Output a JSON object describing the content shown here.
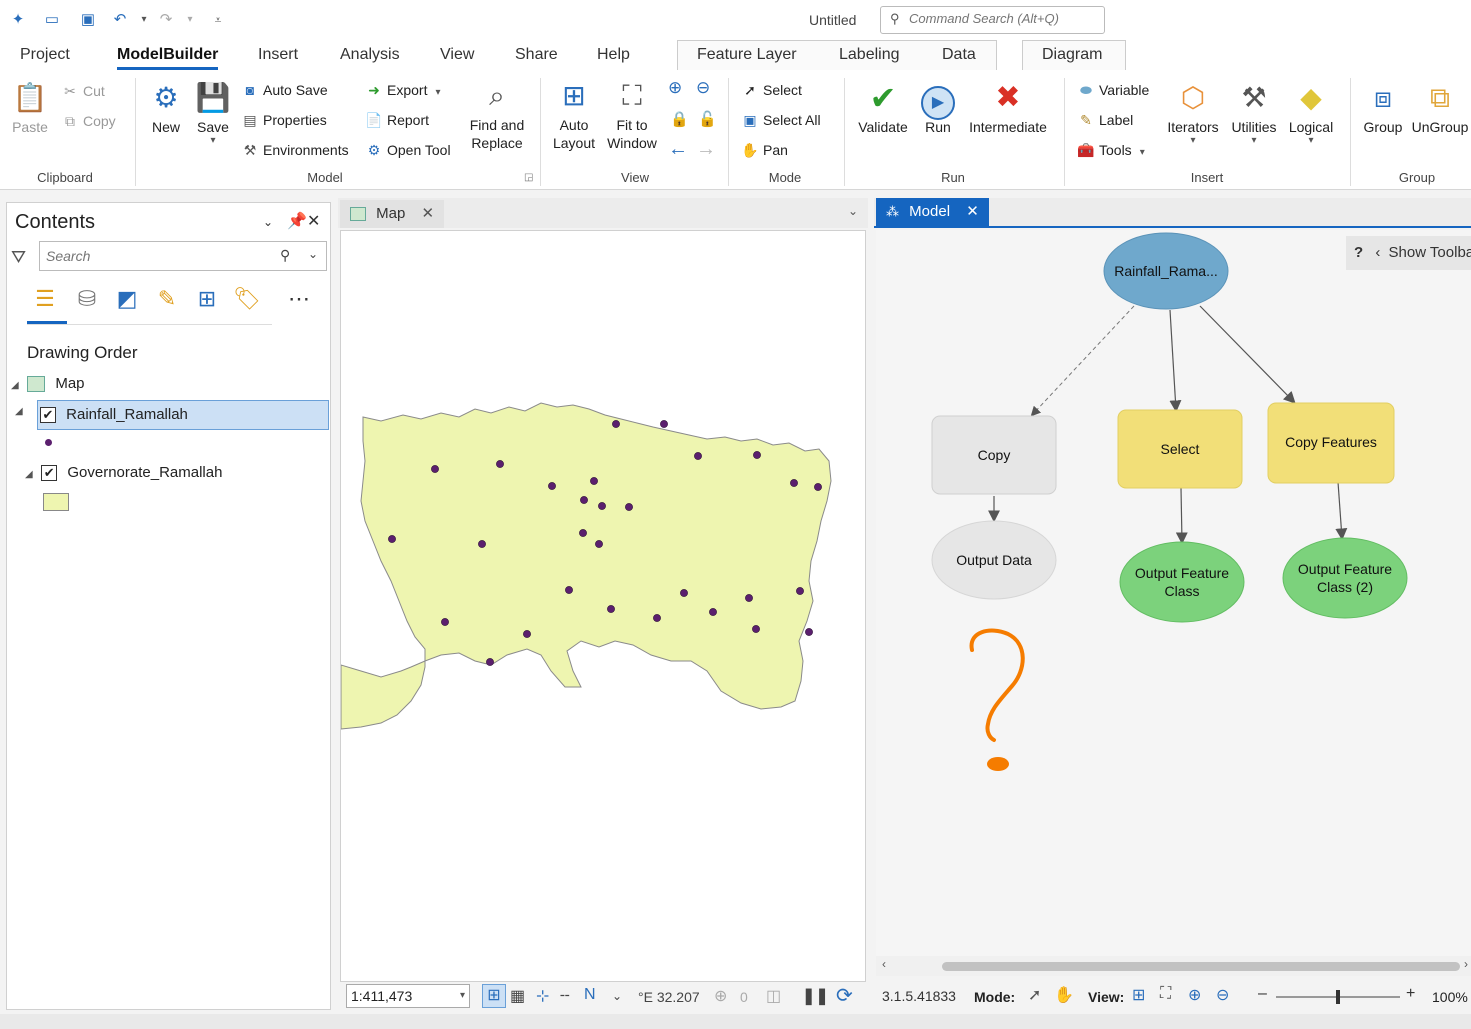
{
  "app": {
    "doc_title": "Untitled",
    "command_search_placeholder": "Command Search (Alt+Q)"
  },
  "ribbon_tabs": [
    "Project",
    "ModelBuilder",
    "Insert",
    "Analysis",
    "View",
    "Share",
    "Help"
  ],
  "context_tabs": [
    "Feature Layer",
    "Labeling",
    "Data",
    "Diagram"
  ],
  "ribbon": {
    "clipboard": {
      "label": "Clipboard",
      "paste": "Paste",
      "cut": "Cut",
      "copy": "Copy"
    },
    "model": {
      "label": "Model",
      "new": "New",
      "save": "Save",
      "auto_save": "Auto Save",
      "properties": "Properties",
      "environments": "Environments",
      "export": "Export",
      "report": "Report",
      "open_tool": "Open Tool",
      "find_replace_1": "Find and",
      "find_replace_2": "Replace"
    },
    "view": {
      "label": "View",
      "auto_layout_1": "Auto",
      "auto_layout_2": "Layout",
      "fit_window_1": "Fit to",
      "fit_window_2": "Window"
    },
    "mode": {
      "label": "Mode",
      "select": "Select",
      "select_all": "Select All",
      "pan": "Pan"
    },
    "run": {
      "label": "Run",
      "validate": "Validate",
      "run": "Run",
      "intermediate": "Intermediate"
    },
    "insert": {
      "label": "Insert",
      "variable": "Variable",
      "label_btn": "Label",
      "tools": "Tools",
      "iterators": "Iterators",
      "utilities": "Utilities",
      "logical": "Logical"
    },
    "group": {
      "label": "Group",
      "group": "Group",
      "ungroup": "UnGroup"
    }
  },
  "contents": {
    "title": "Contents",
    "search_placeholder": "Search",
    "drawing_order": "Drawing Order",
    "map_name": "Map",
    "layers": [
      {
        "name": "Rainfall_Ramallah",
        "selected": true,
        "symbol_color": "#5b1f6e"
      },
      {
        "name": "Governorate_Ramallah",
        "selected": false,
        "symbol_color": "#eef5b0"
      }
    ]
  },
  "map_view": {
    "tab": "Map",
    "scale": "1:411,473",
    "coord": "°E 32.207",
    "selected_count": "0",
    "polygon_fill": "#eef5b0",
    "point_color": "#5b1f6e"
  },
  "model_view": {
    "tab": "Model",
    "show_toolbar": "Show Toolbar",
    "version": "3.1.5.41833",
    "mode_label": "Mode:",
    "view_label": "View:",
    "zoom": "100%",
    "nodes": {
      "input": "Rainfall_Rama...",
      "copy": "Copy",
      "select": "Select",
      "copy_features": "Copy Features",
      "output_data": "Output Data",
      "out_fc_1": "Output Feature",
      "out_fc_2": "Class",
      "out_fc2_1": "Output Feature",
      "out_fc2_2": "Class (2)"
    },
    "colors": {
      "data_blue": "#6fa8cc",
      "tool_yellow": "#f2df78",
      "tool_gray": "#e6e6e6",
      "output_green": "#7cd27c",
      "annotation_orange": "#f57c00"
    }
  }
}
